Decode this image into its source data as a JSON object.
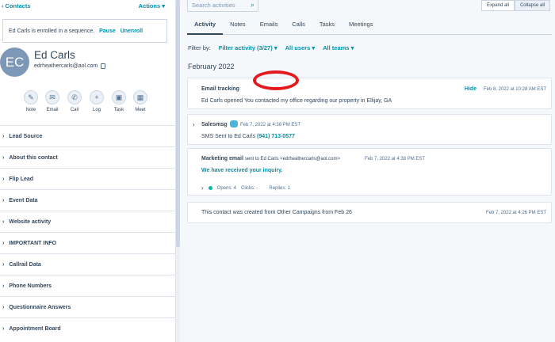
{
  "sidebar": {
    "back_label": "Contacts",
    "actions_label": "Actions",
    "sequence_msg": "Ed Carls is enrolled in a sequence.",
    "sequence_pause": "Pause",
    "sequence_unenroll": "Unenroll",
    "avatar_initials": "EC",
    "contact_name": "Ed Carls",
    "contact_email": "edrheathercarls@aol.com",
    "quick_actions": [
      "Note",
      "Email",
      "Call",
      "Log",
      "Task",
      "Meet"
    ],
    "sections": [
      "Lead Source",
      "About this contact",
      "Flip Lead",
      "Event Data",
      "Website activity",
      "IMPORTANT INFO",
      "Callrail Data",
      "Phone Numbers",
      "Questionnaire Answers",
      "Appointment Board"
    ]
  },
  "main": {
    "search_placeholder": "Search activities",
    "expand_all": "Expand all",
    "collapse_all": "Collapse all",
    "tabs": [
      "Activity",
      "Notes",
      "Emails",
      "Calls",
      "Tasks",
      "Meetings"
    ],
    "filter_by_label": "Filter by:",
    "filter_activity": "Filter activity (3/27)",
    "filter_users": "All users",
    "filter_teams": "All teams",
    "month": "February 2022",
    "cards": {
      "tracking": {
        "title": "Email tracking",
        "hide": "Hide",
        "date": "Feb 8, 2022 at 10:28 AM EST",
        "body": "Ed Carls opened You contacted my office regarding our property in Ellijay, GA"
      },
      "sms": {
        "title": "Salesmsg",
        "date": "Feb 7, 2022 at 4:38 PM EST",
        "body_prefix": "SMS Sent to Ed Carls",
        "phone": "(941) 713-0577"
      },
      "marketing": {
        "title": "Marketing email",
        "subtitle": "sent to Ed Carls <edrheathercarls@aol.com>",
        "date": "Feb 7, 2022 at 4:38 PM EST",
        "headline": "We have received your inquiry.",
        "opens": "Opens: 4",
        "clicks": "Clicks: -",
        "replies": "Replies: 1"
      },
      "created": {
        "body": "This contact was created from Other Campaigns from Feb 26",
        "date": "Feb 7, 2022 at 4:26 PM EST"
      }
    }
  },
  "colors": {
    "accent": "#0091ae",
    "highlight_ring": "#e5191e"
  }
}
